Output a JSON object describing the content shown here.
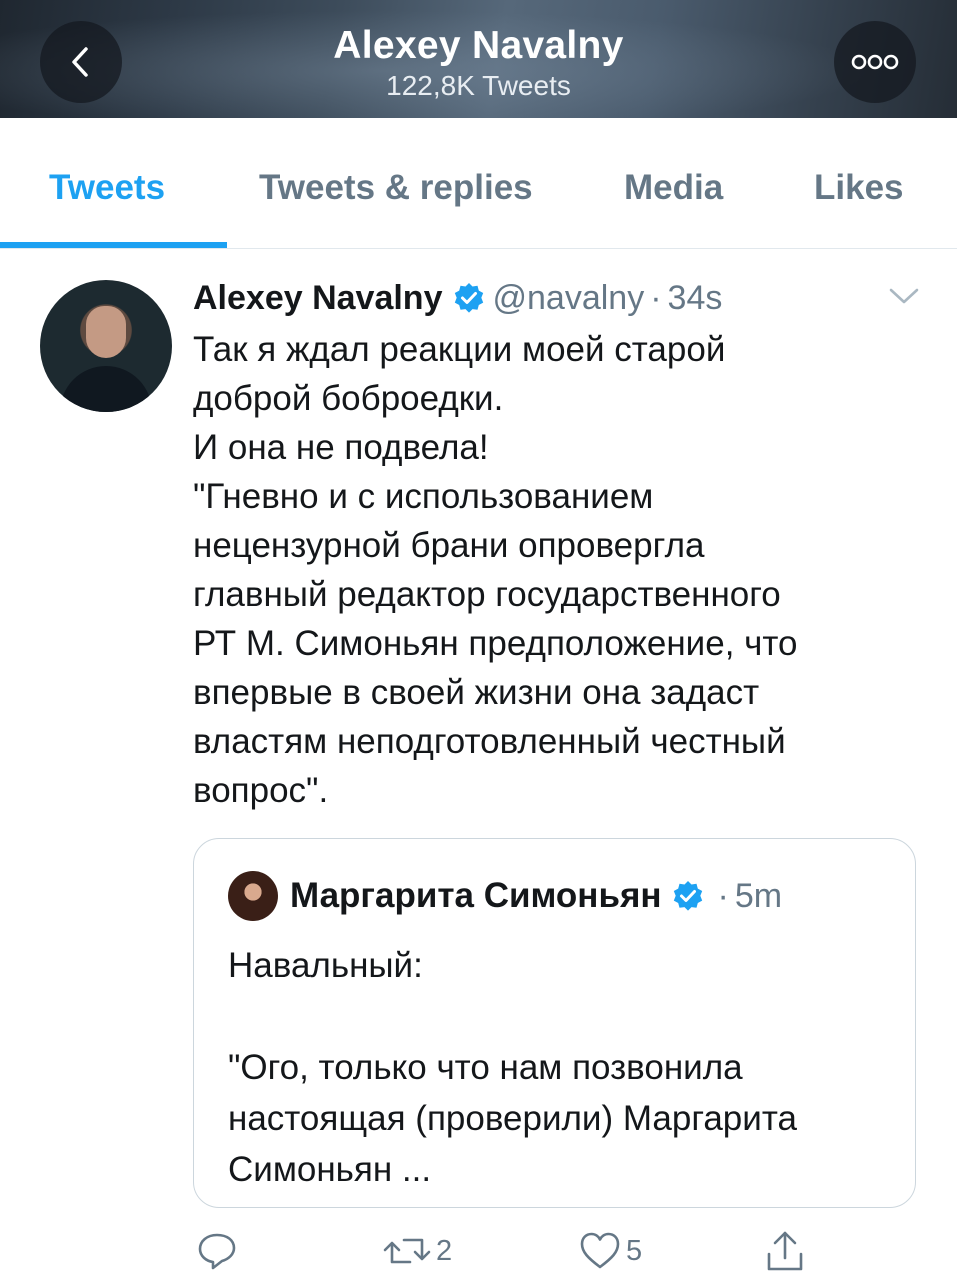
{
  "header": {
    "title": "Alexey Navalny",
    "subtitle": "122,8K Tweets",
    "back_icon": "chevron-left-icon",
    "more_icon": "more-dots-icon"
  },
  "tabs": [
    {
      "label": "Tweets",
      "active": true
    },
    {
      "label": "Tweets & replies",
      "active": false
    },
    {
      "label": "Media",
      "active": false
    },
    {
      "label": "Likes",
      "active": false
    }
  ],
  "tweet": {
    "author_name": "Alexey Navalny",
    "handle": "@navalny",
    "separator": "·",
    "time": "34s",
    "text": "Так я ждал реакции моей старой\nдоброй боброедки.\nИ она не подвела!\n\"Гневно и с использованием\nнецензурной брани опровергла\nглавный редактор государственного\nРТ М. Симоньян предположение, что\nвпервые в своей жизни она задаст\nвластям неподготовленный честный\nвопрос\".",
    "quote": {
      "author_name": "Маргарита Симоньян",
      "separator": "·",
      "time": "5m",
      "text": "Навальный:\n\n\"Ого, только что нам позвонила\nнастоящая (проверили) Маргарита\nСимоньян ..."
    },
    "actions": {
      "reply_count": "",
      "retweet_count": "2",
      "like_count": "5"
    }
  },
  "colors": {
    "accent": "#1da1f2",
    "secondary_text": "#657786",
    "primary_text": "#14171a",
    "border": "#e1e8ed"
  }
}
